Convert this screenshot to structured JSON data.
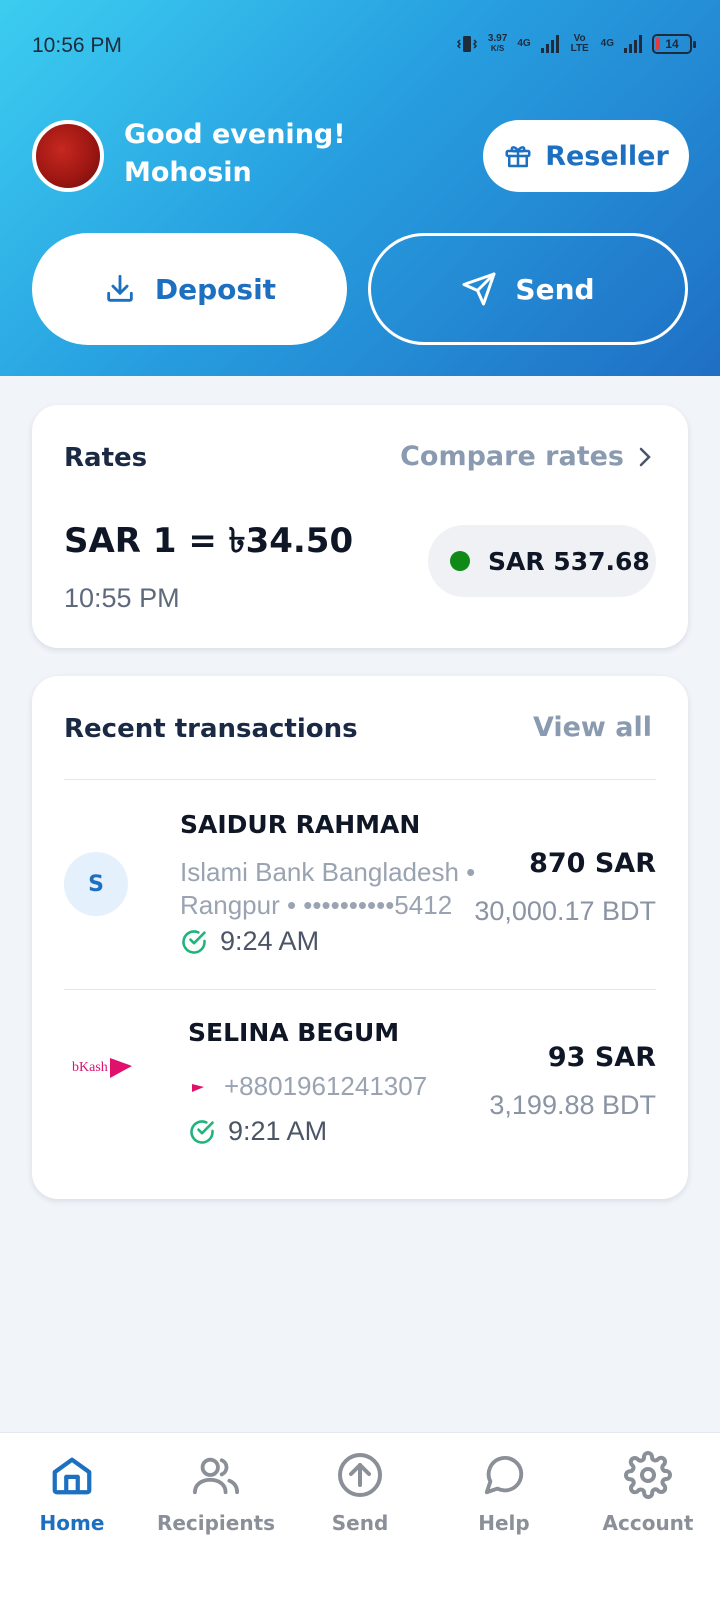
{
  "status_bar": {
    "time": "10:56 PM",
    "net_speed": "3.97",
    "net_speed_unit": "K/S",
    "network1": "4G",
    "volte": "Vo LTE",
    "network2": "4G",
    "battery": "14"
  },
  "header": {
    "greeting_line1": "Good evening!",
    "greeting_line2": "Mohosin",
    "reseller_label": "Reseller",
    "deposit_label": "Deposit",
    "send_label": "Send"
  },
  "rates": {
    "title": "Rates",
    "compare_label": "Compare rates",
    "rate_text": "SAR 1 = ৳34.50",
    "time": "10:55 PM",
    "balance": "SAR 537.68",
    "balance_dot_color": "#0f8a16"
  },
  "transactions": {
    "title": "Recent transactions",
    "view_all": "View all",
    "items": [
      {
        "initial": "S",
        "name": "SAIDUR RAHMAN",
        "detail_line1": "Islami Bank Bangladesh •",
        "detail_line2": "Rangpur • ••••••••••5412",
        "time": "9:24 AM",
        "amount": "870 SAR",
        "bdt": "30,000.17 BDT"
      },
      {
        "logo_text": "bKash",
        "name": "SELINA BEGUM",
        "phone": "+8801961241307",
        "time": "9:21 AM",
        "amount": "93 SAR",
        "bdt": "3,199.88 BDT"
      }
    ]
  },
  "nav": {
    "items": [
      {
        "label": "Home",
        "icon": "home-icon",
        "active": true
      },
      {
        "label": "Recipients",
        "icon": "users-icon",
        "active": false
      },
      {
        "label": "Send",
        "icon": "arrow-up-circle-icon",
        "active": false
      },
      {
        "label": "Help",
        "icon": "chat-bubble-icon",
        "active": false
      },
      {
        "label": "Account",
        "icon": "gear-icon",
        "active": false
      }
    ]
  },
  "colors": {
    "primary": "#1d6fbf",
    "success": "#1fb57a",
    "muted": "#8a9ab0"
  }
}
